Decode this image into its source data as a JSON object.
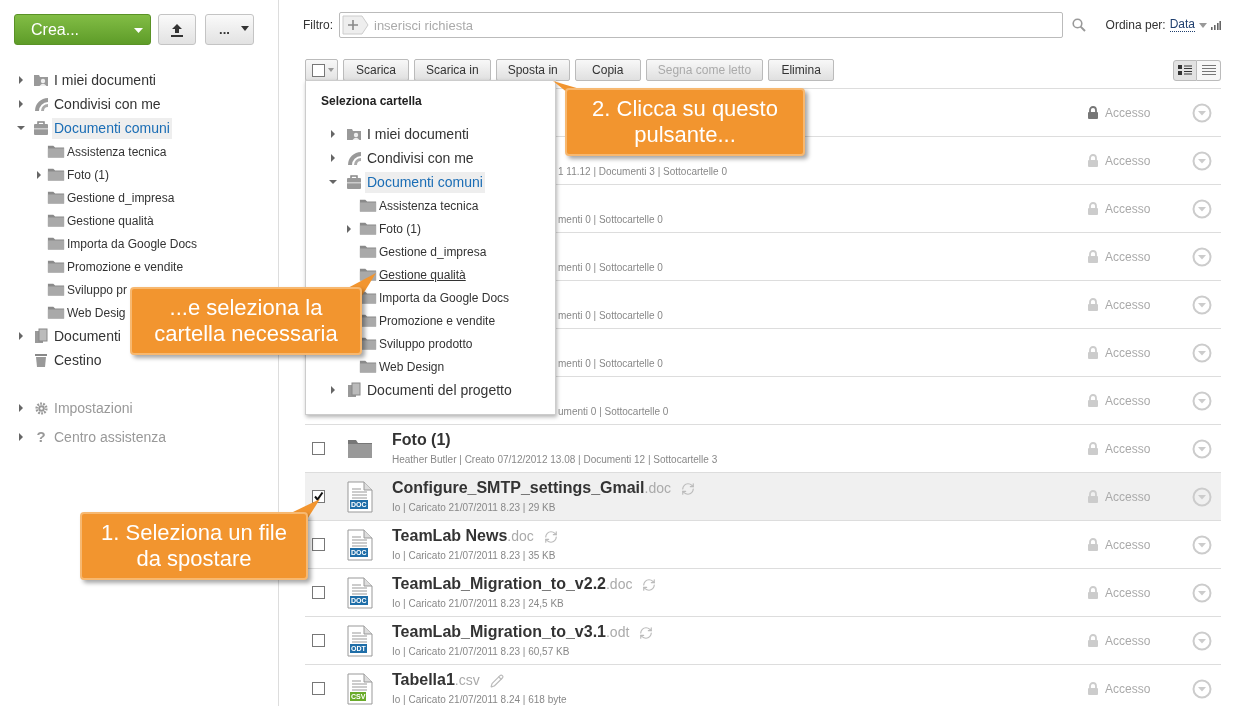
{
  "top_buttons": {
    "create": "Crea...",
    "more": "..."
  },
  "sidebar": {
    "tree": [
      {
        "label": "I miei documenti",
        "kind": "my",
        "expanded": false,
        "selected": false
      },
      {
        "label": "Condivisi con me",
        "kind": "shared",
        "expanded": false,
        "selected": false
      },
      {
        "label": "Documenti comuni",
        "kind": "common",
        "expanded": true,
        "selected": true,
        "children": [
          {
            "label": "Assistenza tecnica",
            "kind": "folder",
            "selected": false
          },
          {
            "label": "Foto (1)",
            "kind": "folder",
            "expanded": false,
            "selected": false
          },
          {
            "label": "Gestione d_impresa",
            "kind": "folder",
            "selected": false
          },
          {
            "label": "Gestione qualità",
            "kind": "folder",
            "selected": false
          },
          {
            "label": "Importa da Google Docs",
            "kind": "folder",
            "selected": false
          },
          {
            "label": "Promozione e vendite",
            "kind": "folder",
            "selected": false
          },
          {
            "label": "Sviluppo pr",
            "kind": "folder",
            "selected": false
          },
          {
            "label": "Web Desig",
            "kind": "folder",
            "selected": false
          }
        ]
      },
      {
        "label": "Documenti",
        "kind": "project",
        "expanded": false,
        "selected": false
      },
      {
        "label": "Cestino",
        "kind": "trash",
        "selected": false
      }
    ],
    "footer": [
      {
        "label": "Impostazioni",
        "kind": "settings",
        "expanded": false
      },
      {
        "label": "Centro assistenza",
        "kind": "help",
        "symbol": "?",
        "expanded": false
      }
    ]
  },
  "filter": {
    "label": "Filtro:",
    "placeholder": "inserisci richiesta"
  },
  "sort": {
    "label": "Ordina per:",
    "value": "Data"
  },
  "select_all": {
    "checked": false
  },
  "actions": [
    {
      "label": "Scarica",
      "disabled": false
    },
    {
      "label": "Scarica in",
      "disabled": false
    },
    {
      "label": "Sposta in",
      "disabled": false
    },
    {
      "label": "Copia",
      "disabled": false
    },
    {
      "label": "Segna come letto",
      "disabled": true
    },
    {
      "label": "Elimina",
      "disabled": false
    }
  ],
  "view_modes": [
    {
      "kind": "detailed",
      "selected": true
    },
    {
      "kind": "compact",
      "selected": false
    }
  ],
  "folder_picker": {
    "title": "Seleziona cartella",
    "tree": [
      {
        "label": "I miei documenti",
        "kind": "my",
        "expanded": false,
        "selected": false
      },
      {
        "label": "Condivisi con me",
        "kind": "shared",
        "expanded": false,
        "selected": false
      },
      {
        "label": "Documenti comuni",
        "kind": "common",
        "expanded": true,
        "selected": true,
        "children": [
          {
            "label": "Assistenza tecnica",
            "kind": "folder",
            "selected": false,
            "hovered": false
          },
          {
            "label": "Foto (1)",
            "kind": "folder",
            "expanded": false,
            "selected": false,
            "hovered": false
          },
          {
            "label": "Gestione d_impresa",
            "kind": "folder",
            "selected": false,
            "hovered": false
          },
          {
            "label": "Gestione qualità",
            "kind": "folder",
            "selected": false,
            "hovered": true
          },
          {
            "label": "Importa da Google Docs",
            "kind": "folder",
            "selected": false,
            "hovered": false
          },
          {
            "label": "Promozione e vendite",
            "kind": "folder",
            "selected": false,
            "hovered": false
          },
          {
            "label": "Sviluppo prodotto",
            "kind": "folder",
            "selected": false,
            "hovered": false
          },
          {
            "label": "Web Design",
            "kind": "folder",
            "selected": false,
            "hovered": false
          }
        ]
      },
      {
        "label": "Documenti del progetto",
        "kind": "project",
        "expanded": false,
        "selected": false
      }
    ]
  },
  "files": [
    {
      "kind": "covered",
      "selected": false,
      "access": "Accesso",
      "access_active": true
    },
    {
      "kind": "covered",
      "selected": false,
      "meta": "1 11.12 | Documenti 3 | Sottocartelle 0",
      "access": "Accesso",
      "access_active": false
    },
    {
      "kind": "covered",
      "selected": false,
      "meta": "menti 0 | Sottocartelle 0",
      "access": "Accesso",
      "access_active": false
    },
    {
      "kind": "covered",
      "selected": false,
      "meta": "menti 0 | Sottocartelle 0",
      "access": "Accesso",
      "access_active": false
    },
    {
      "kind": "covered",
      "selected": false,
      "meta": "menti 0 | Sottocartelle 0",
      "access": "Accesso",
      "access_active": false
    },
    {
      "kind": "covered",
      "selected": false,
      "meta": "menti 0 | Sottocartelle 0",
      "access": "Accesso",
      "access_active": false
    },
    {
      "kind": "covered",
      "selected": false,
      "meta": "umenti 0 | Sottocartelle 0",
      "access": "Accesso",
      "access_active": false
    },
    {
      "kind": "folder",
      "checked": false,
      "selected": false,
      "name": "Foto (1)",
      "meta": "Heather Butler | Creato 07/12/2012 13.08 | Documenti 12 | Sottocartelle 3",
      "access": "Accesso",
      "access_active": false
    },
    {
      "kind": "file",
      "checked": true,
      "selected": true,
      "name": "Configure_SMTP_settings_Gmail",
      "ext": ".doc",
      "type_label": "DOC",
      "color": "#1f6ea8",
      "action": {
        "kind": "sync"
      },
      "meta": "Io | Caricato 21/07/2011 8.23 | 29 KB",
      "access": "Accesso",
      "access_active": false
    },
    {
      "kind": "file",
      "checked": false,
      "selected": false,
      "name": "TeamLab News",
      "ext": ".doc",
      "type_label": "DOC",
      "color": "#1f6ea8",
      "action": {
        "kind": "sync"
      },
      "meta": "Io | Caricato 21/07/2011 8.23 | 35 KB",
      "access": "Accesso",
      "access_active": false
    },
    {
      "kind": "file",
      "checked": false,
      "selected": false,
      "name": "TeamLab_Migration_to_v2.2",
      "ext": ".doc",
      "type_label": "DOC",
      "color": "#1f6ea8",
      "action": {
        "kind": "sync"
      },
      "meta": "Io | Caricato 21/07/2011 8.23 | 24,5 KB",
      "access": "Accesso",
      "access_active": false
    },
    {
      "kind": "file",
      "checked": false,
      "selected": false,
      "name": "TeamLab_Migration_to_v3.1",
      "ext": ".odt",
      "type_label": "ODT",
      "color": "#1f6ea8",
      "action": {
        "kind": "sync"
      },
      "meta": "Io | Caricato 21/07/2011 8.23 | 60,57 KB",
      "access": "Accesso",
      "access_active": false
    },
    {
      "kind": "file",
      "checked": false,
      "selected": false,
      "name": "Tabella1",
      "ext": ".csv",
      "type_label": "CSV",
      "color": "#6aab2a",
      "action": {
        "kind": "edit"
      },
      "meta": "Io | Caricato 21/07/2011 8.24 | 618 byte",
      "access": "Accesso",
      "access_active": false
    }
  ],
  "callouts": [
    "2. Clicca su questo pulsante...",
    "...e seleziona la cartella necessaria",
    "1. Seleziona un file da spostare"
  ]
}
